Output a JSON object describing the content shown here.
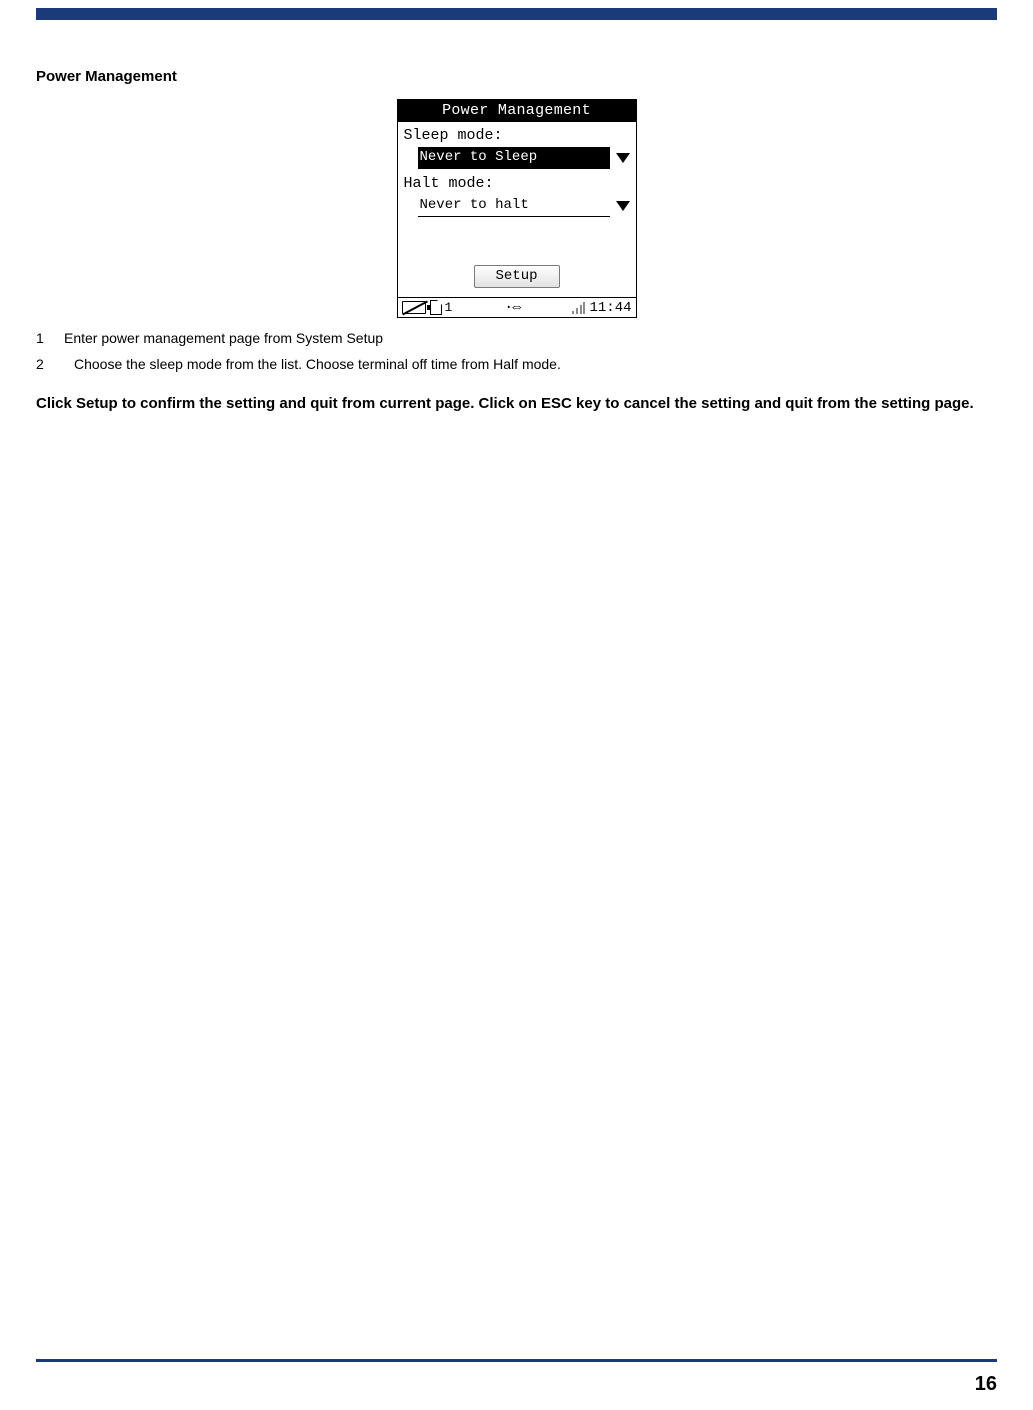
{
  "heading": "Power Management",
  "device": {
    "title": "Power Management",
    "sleepLabel": "Sleep mode:",
    "sleepValue": "Never to Sleep",
    "haltLabel": "Halt mode:",
    "haltValue": "Never to halt",
    "setupButton": "Setup",
    "status": {
      "simText": "1",
      "syncGlyph": "·⇔",
      "time": "11:44"
    }
  },
  "list": [
    {
      "num": "1",
      "text": "Enter power management page from System Setup"
    },
    {
      "num": "2",
      "text": "Choose the sleep mode from the list. Choose terminal off time from Half mode."
    }
  ],
  "instruction": "Click Setup to confirm the setting and quit from current page. Click on ESC key to cancel the setting and quit from the setting page.",
  "pageNumber": "16"
}
